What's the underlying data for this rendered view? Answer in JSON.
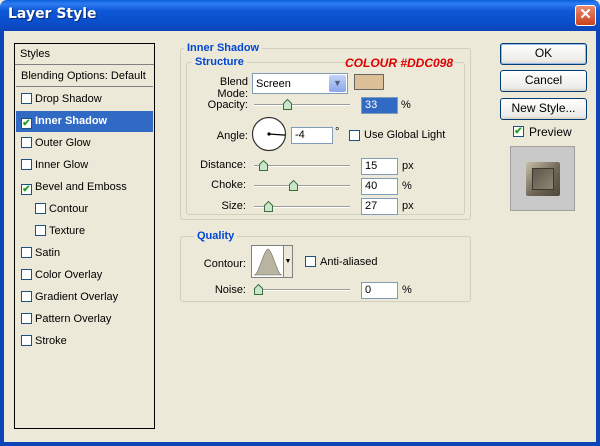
{
  "window": {
    "title": "Layer Style",
    "close": "✕"
  },
  "styles_panel": {
    "header": "Styles",
    "blending": "Blending Options: Default",
    "items": [
      {
        "label": "Drop Shadow",
        "checked": false,
        "indent": false
      },
      {
        "label": "Inner Shadow",
        "checked": true,
        "indent": false,
        "selected": true
      },
      {
        "label": "Outer Glow",
        "checked": false,
        "indent": false
      },
      {
        "label": "Inner Glow",
        "checked": false,
        "indent": false
      },
      {
        "label": "Bevel and Emboss",
        "checked": true,
        "indent": false
      },
      {
        "label": "Contour",
        "checked": false,
        "indent": true
      },
      {
        "label": "Texture",
        "checked": false,
        "indent": true
      },
      {
        "label": "Satin",
        "checked": false,
        "indent": false
      },
      {
        "label": "Color Overlay",
        "checked": false,
        "indent": false
      },
      {
        "label": "Gradient Overlay",
        "checked": false,
        "indent": false
      },
      {
        "label": "Pattern Overlay",
        "checked": false,
        "indent": false
      },
      {
        "label": "Stroke",
        "checked": false,
        "indent": false
      }
    ]
  },
  "inner_shadow": {
    "title": "Inner Shadow",
    "structure": {
      "title": "Structure",
      "annotation": "COLOUR #DDC098",
      "annotation_color": "#e00000",
      "blend_mode_label": "Blend Mode:",
      "blend_mode_value": "Screen",
      "swatch_color": "#ddc098",
      "opacity_label": "Opacity:",
      "opacity_value": "33",
      "opacity_unit": "%",
      "opacity_level": 33,
      "angle_label": "Angle:",
      "angle_value": "-4",
      "angle_unit": "°",
      "global_light_label": "Use Global Light",
      "global_light_checked": false,
      "distance_label": "Distance:",
      "distance_value": "15",
      "distance_unit": "px",
      "distance_level": 6,
      "choke_label": "Choke:",
      "choke_value": "40",
      "choke_unit": "%",
      "choke_level": 40,
      "size_label": "Size:",
      "size_value": "27",
      "size_unit": "px",
      "size_level": 11
    },
    "quality": {
      "title": "Quality",
      "contour_label": "Contour:",
      "anti_aliased_label": "Anti-aliased",
      "anti_aliased_checked": false,
      "noise_label": "Noise:",
      "noise_value": "0",
      "noise_unit": "%",
      "noise_level": 0
    }
  },
  "buttons": {
    "ok": "OK",
    "cancel": "Cancel",
    "new_style": "New Style..."
  },
  "preview": {
    "label": "Preview",
    "checked": true
  }
}
